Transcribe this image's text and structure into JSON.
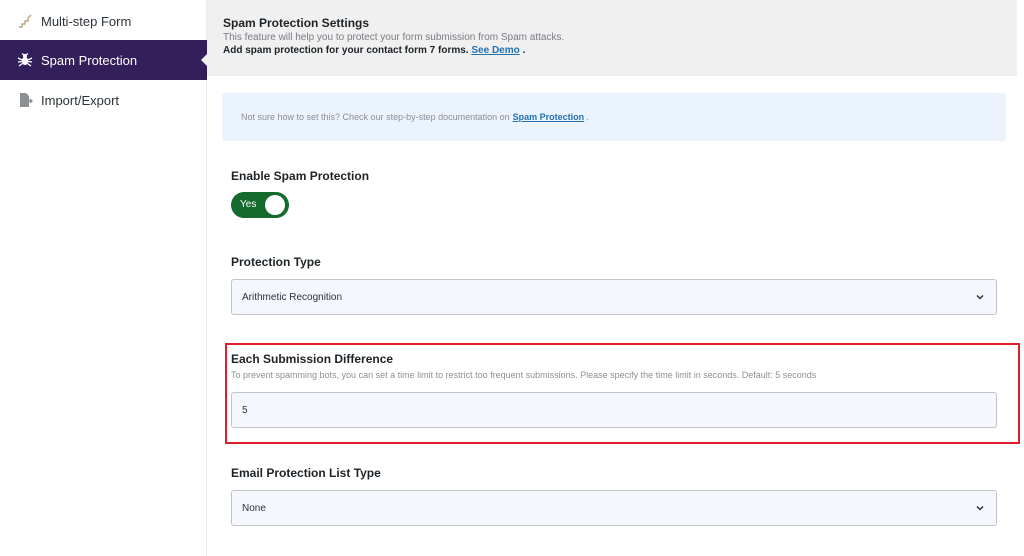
{
  "sidebar": {
    "items": [
      {
        "label": "Multi-step Form",
        "icon": "stairs-icon"
      },
      {
        "label": "Spam Protection",
        "icon": "bug-icon"
      },
      {
        "label": "Import/Export",
        "icon": "file-export-icon"
      }
    ],
    "active_index": 1,
    "active_color": "#33205a"
  },
  "header": {
    "title": "Spam Protection Settings",
    "subtitle": "This feature will help you to protect your form submission from Spam attacks.",
    "add_text": "Add spam protection for your contact form 7 forms.",
    "demo_link": "See Demo",
    "demo_suffix": "."
  },
  "notice": {
    "text": "Not sure how to set this? Check our step-by-step documentation on",
    "link": "Spam Protection",
    "suffix": "."
  },
  "enable": {
    "label": "Enable Spam Protection",
    "toggle_text": "Yes",
    "toggle_on": true,
    "toggle_color": "#156a2d"
  },
  "protection_type": {
    "label": "Protection Type",
    "value": "Arithmetic Recognition"
  },
  "submission_difference": {
    "label": "Each Submission Difference",
    "description": "To prevent spamming bots, you can set a time limit to restrict too frequent submissions. Please specify the time limit in seconds. Default: 5 seconds",
    "value": "5",
    "highlight_color": "#e11d2a"
  },
  "email_list_type": {
    "label": "Email Protection List Type",
    "value": "None"
  }
}
